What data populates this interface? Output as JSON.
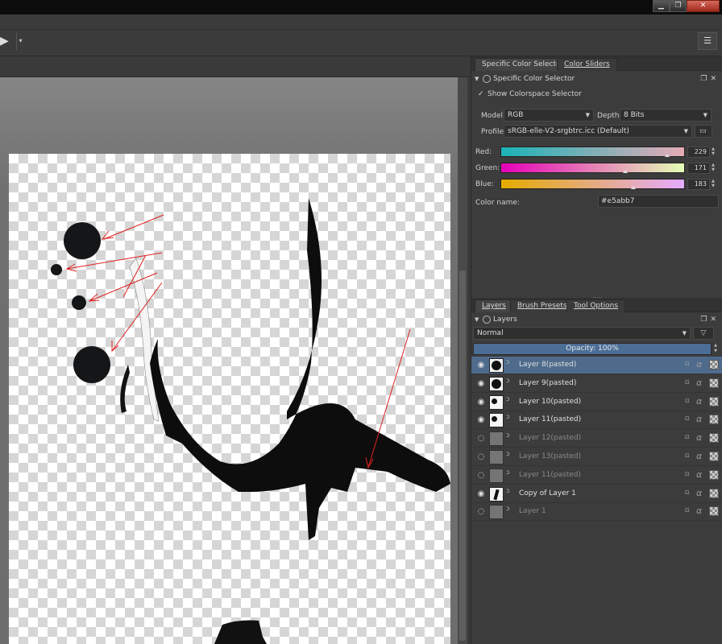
{
  "window": {
    "min_icon": "window-minimize-icon",
    "max_icon": "window-restore-icon",
    "close_icon": "window-close-icon",
    "min_glyph": "▁",
    "max_glyph": "❐",
    "close_glyph": "✕"
  },
  "toolbar": {
    "play_glyph": "▶",
    "dropdown_glyph": "▾",
    "menu_glyph": "☰"
  },
  "color_panel": {
    "tabs": [
      {
        "label": "Specific Color Selector",
        "active": true
      },
      {
        "label": "Color Sliders",
        "active": false
      }
    ],
    "title": "Specific Color Selector",
    "show_colorspace": {
      "checked": true,
      "label": "Show Colorspace Selector",
      "check_glyph": "✓"
    },
    "model": {
      "label": "Model:",
      "value": "RGB"
    },
    "depth": {
      "label": "Depth:",
      "value": "8 Bits"
    },
    "profile": {
      "label": "Profile:",
      "value": "sRGB-elle-V2-srgbtrc.icc (Default)"
    },
    "sliders": [
      {
        "label": "Red:",
        "value": "229",
        "fraction": 0.898,
        "gradient": [
          "#1ab3b7",
          "#e6abb7"
        ]
      },
      {
        "label": "Green:",
        "value": "171",
        "fraction": 0.671,
        "gradient": [
          "#e500b7",
          "#e5ffb7"
        ]
      },
      {
        "label": "Blue:",
        "value": "183",
        "fraction": 0.718,
        "gradient": [
          "#e5ab00",
          "#e5abff"
        ]
      }
    ],
    "color_name": {
      "label": "Color name:",
      "value": "#e5abb7"
    },
    "splitter_glyph": "....."
  },
  "layers_panel": {
    "tabs": [
      {
        "label": "Layers",
        "active": true
      },
      {
        "label": "Brush Presets",
        "active": false
      },
      {
        "label": "Tool Options",
        "active": false
      }
    ],
    "title": "Layers",
    "blend_mode": "Normal",
    "filter_glyph": "▽",
    "opacity": "Opacity:  100%",
    "layers": [
      {
        "name": "Layer 8(pasted)",
        "visible": true,
        "selected": true,
        "thumb": "dot-big"
      },
      {
        "name": "Layer 9(pasted)",
        "visible": true,
        "selected": false,
        "thumb": "dot-big"
      },
      {
        "name": "Layer 10(pasted)",
        "visible": true,
        "selected": false,
        "thumb": "dot-small"
      },
      {
        "name": "Layer 11(pasted)",
        "visible": true,
        "selected": false,
        "thumb": "checker-dot"
      },
      {
        "name": "Layer 12(pasted)",
        "visible": false,
        "selected": false,
        "thumb": "dim"
      },
      {
        "name": "Layer 13(pasted)",
        "visible": false,
        "selected": false,
        "thumb": "dim"
      },
      {
        "name": "Layer 11(pasted)",
        "visible": false,
        "selected": false,
        "thumb": "dim"
      },
      {
        "name": "Copy of Layer 1",
        "visible": true,
        "selected": false,
        "thumb": "art"
      },
      {
        "name": "Layer 1",
        "visible": false,
        "selected": false,
        "thumb": "dim"
      }
    ],
    "eye_glyph": "👁",
    "hidden_glyph": "◌",
    "alpha_glyph": "α",
    "lock_glyph": "🔓",
    "link_glyph": "ↄ"
  }
}
